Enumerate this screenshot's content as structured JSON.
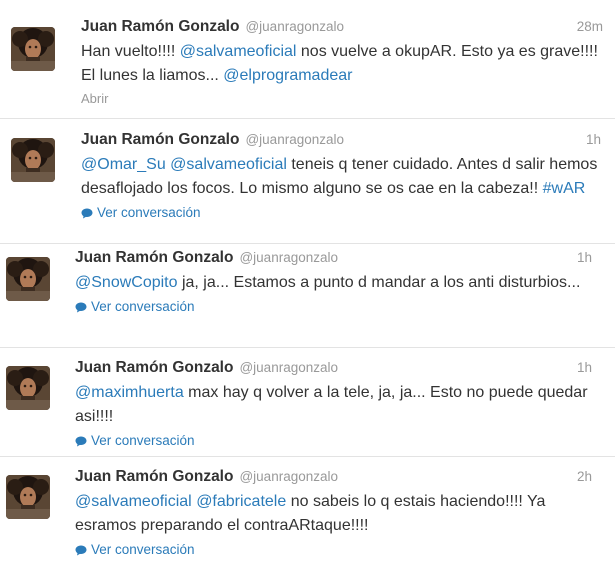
{
  "tweets": [
    {
      "name": "Juan Ramón Gonzalo",
      "handle": "@juanragonzalo",
      "time": "28m",
      "segments": [
        {
          "t": "text",
          "v": "Han vuelto!!!! "
        },
        {
          "t": "mention",
          "v": "@salvameoficial"
        },
        {
          "t": "text",
          "v": " nos vuelve a okupAR. Esto ya es grave!!!! El lunes la liamos... "
        },
        {
          "t": "mention",
          "v": "@elprogramadear"
        }
      ],
      "action": "Abrir"
    },
    {
      "name": "Juan Ramón Gonzalo",
      "handle": "@juanragonzalo",
      "time": "1h",
      "segments": [
        {
          "t": "mention",
          "v": "@Omar_Su"
        },
        {
          "t": "text",
          "v": " "
        },
        {
          "t": "mention",
          "v": "@salvameoficial"
        },
        {
          "t": "text",
          "v": " teneis q tener cuidado. Antes d salir hemos desaflojado los focos. Lo mismo alguno se os cae en la cabeza!! "
        },
        {
          "t": "hashtag",
          "v": "#wAR"
        }
      ],
      "action": "Ver conversación"
    },
    {
      "name": "Juan Ramón Gonzalo",
      "handle": "@juanragonzalo",
      "time": "1h",
      "segments": [
        {
          "t": "mention",
          "v": "@SnowCopito"
        },
        {
          "t": "text",
          "v": " ja, ja... Estamos a punto d mandar a los anti disturbios..."
        }
      ],
      "action": "Ver conversación"
    },
    {
      "name": "Juan Ramón Gonzalo",
      "handle": "@juanragonzalo",
      "time": "1h",
      "segments": [
        {
          "t": "mention",
          "v": "@maximhuerta"
        },
        {
          "t": "text",
          "v": " max hay q volver a la tele, ja, ja... Esto no puede quedar asi!!!!"
        }
      ],
      "action": "Ver conversación"
    },
    {
      "name": "Juan Ramón Gonzalo",
      "handle": "@juanragonzalo",
      "time": "2h",
      "segments": [
        {
          "t": "mention",
          "v": "@salvameoficial"
        },
        {
          "t": "text",
          "v": " "
        },
        {
          "t": "mention",
          "v": "@fabricatele"
        },
        {
          "t": "text",
          "v": " no sabeis lo q estais haciendo!!!! Ya esramos preparando el contraARtaque!!!!"
        }
      ],
      "action": "Ver conversación"
    }
  ],
  "icons": {
    "conversation": "speech-bubble-icon"
  },
  "colors": {
    "link": "#2b7bb9",
    "meta": "#999999",
    "text": "#333333"
  }
}
